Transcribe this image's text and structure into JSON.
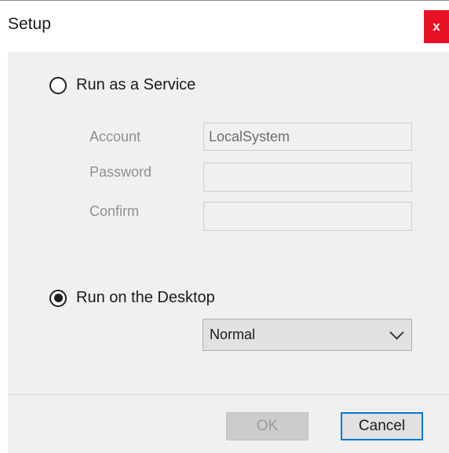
{
  "window": {
    "title": "Setup",
    "close_label": "x"
  },
  "service_option": {
    "label": "Run as a Service",
    "selected": false,
    "fields": {
      "account_label": "Account",
      "account_value": "LocalSystem",
      "password_label": "Password",
      "password_value": "",
      "confirm_label": "Confirm",
      "confirm_value": ""
    }
  },
  "desktop_option": {
    "label": "Run on the Desktop",
    "selected": true,
    "mode_selected": "Normal"
  },
  "buttons": {
    "ok_label": "OK",
    "cancel_label": "Cancel"
  },
  "colors": {
    "close_button": "#e81123",
    "dialog_background": "#f0f0f0",
    "focus_border": "#0078d7"
  }
}
